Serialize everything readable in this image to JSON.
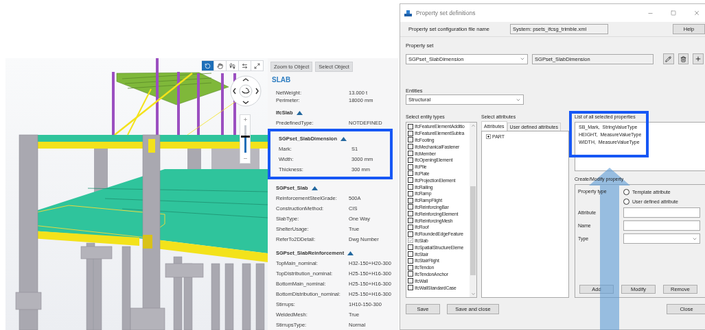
{
  "viewer": {
    "tools": [
      {
        "kind": "orbit",
        "selected": true
      },
      {
        "kind": "pan",
        "selected": false
      },
      {
        "kind": "walk",
        "selected": false
      },
      {
        "kind": "swap",
        "selected": false
      },
      {
        "kind": "fullscreen",
        "selected": false
      }
    ],
    "zoom_slider": {
      "level": 0.6
    }
  },
  "properties_panel": {
    "buttons": [
      "Zoom to Object",
      "Select Object"
    ],
    "title": "SLAB",
    "rows": [
      {
        "label": "NetWeight:",
        "value": "13.000 t"
      },
      {
        "label": "Perimeter:",
        "value": "18000 mm"
      }
    ],
    "groups": [
      {
        "name": "IfcSlab",
        "expanded": true,
        "highlighted": false,
        "rows": [
          {
            "label": "PredefinedType:",
            "value": "NOTDEFINED"
          }
        ]
      },
      {
        "name": "SGPset_SlabDimension",
        "expanded": true,
        "highlighted": true,
        "rows": [
          {
            "label": "Mark:",
            "value": "S1"
          },
          {
            "label": "Width:",
            "value": "3000 mm"
          },
          {
            "label": "Thickness:",
            "value": "300 mm"
          }
        ]
      },
      {
        "name": "SGPset_Slab",
        "expanded": true,
        "highlighted": false,
        "rows": [
          {
            "label": "ReinforcementSteelGrade:",
            "value": "500A"
          },
          {
            "label": "ConstructionMethod:",
            "value": "CIS"
          },
          {
            "label": "SlabType:",
            "value": "One Way"
          },
          {
            "label": "ShelterUsage:",
            "value": "True"
          },
          {
            "label": "ReferTo2DDetail:",
            "value": "Dwg Number"
          }
        ]
      },
      {
        "name": "SGPset_SlabReinforcement",
        "expanded": true,
        "highlighted": false,
        "rows": [
          {
            "label": "TopMain_nominal:",
            "value": "H32-150+H20-300"
          },
          {
            "label": "TopDistribution_nominal:",
            "value": "H25-150+H16-300"
          },
          {
            "label": "BottomMain_nominal:",
            "value": "H25-150+H16-300"
          },
          {
            "label": "BottomDistribution_nominal:",
            "value": "H25-150+H16-300"
          },
          {
            "label": "Stirrups:",
            "value": "1H10-150-300"
          },
          {
            "label": "WeldedMesh:",
            "value": "True"
          },
          {
            "label": "StirrupsType:",
            "value": "Normal"
          }
        ]
      }
    ]
  },
  "dialog": {
    "title": "Property set definitions",
    "config_file": {
      "label": "Property set configuration file name",
      "value": "System: psets_ifcsg_trimble.xml"
    },
    "help_button": "Help",
    "property_set": {
      "label": "Property set",
      "selected": "SGPset_SlabDimension",
      "name": "SGPset_SlabDimension"
    },
    "entities": {
      "label": "Entities",
      "selected": "Structural"
    },
    "entity_types": {
      "label": "Select entity types",
      "items": [
        {
          "name": "IfcFeatureElementAdditio",
          "checked": false
        },
        {
          "name": "IfcFeatureElementSubtra",
          "checked": false
        },
        {
          "name": "IfcFooting",
          "checked": false
        },
        {
          "name": "IfcMechanicalFastener",
          "checked": false
        },
        {
          "name": "IfcMember",
          "checked": false
        },
        {
          "name": "IfcOpeningElement",
          "checked": false
        },
        {
          "name": "IfcPile",
          "checked": false
        },
        {
          "name": "IfcPlate",
          "checked": false
        },
        {
          "name": "IfcProjectionElement",
          "checked": false
        },
        {
          "name": "IfcRailing",
          "checked": false
        },
        {
          "name": "IfcRamp",
          "checked": false
        },
        {
          "name": "IfcRampFlight",
          "checked": false
        },
        {
          "name": "IfcReinforcingBar",
          "checked": false
        },
        {
          "name": "IfcReinforcingElement",
          "checked": false
        },
        {
          "name": "IfcReinforcingMesh",
          "checked": false
        },
        {
          "name": "IfcRoof",
          "checked": false
        },
        {
          "name": "IfcRoundedEdgeFeature",
          "checked": false
        },
        {
          "name": "IfcSlab",
          "checked": true
        },
        {
          "name": "IfcSpatialStructureEleme",
          "checked": false
        },
        {
          "name": "IfcStair",
          "checked": false
        },
        {
          "name": "IfcStairFlight",
          "checked": false
        },
        {
          "name": "IfcTendon",
          "checked": false
        },
        {
          "name": "IfcTendonAnchor",
          "checked": false
        },
        {
          "name": "IfcWall",
          "checked": false
        },
        {
          "name": "IfcWallStandardCase",
          "checked": false
        }
      ]
    },
    "attributes": {
      "label": "Select attributes",
      "tabs": [
        {
          "label": "Attributes",
          "selected": true
        },
        {
          "label": "User defined attributes",
          "selected": false
        }
      ],
      "tree": [
        {
          "name": "PART"
        }
      ]
    },
    "selected_properties": {
      "label": "List of all selected properties",
      "highlighted": true,
      "items": [
        "SB_Mark,  StringValueType",
        "HEIGHT,  MeasureValueType",
        "WIDTH,  MeasureValueType"
      ]
    },
    "create_modify": {
      "label": "Create/Modify property",
      "property_type_label": "Property type",
      "options": [
        {
          "label": "Template attribute",
          "selected": false
        },
        {
          "label": "User defined attribute",
          "selected": false
        }
      ],
      "fields": [
        {
          "label": "Attribute",
          "kind": "text"
        },
        {
          "label": "Name",
          "kind": "text"
        },
        {
          "label": "Type",
          "kind": "select"
        }
      ],
      "buttons": [
        "Add",
        "Modify",
        "Remove"
      ]
    },
    "footer_buttons": [
      "Save",
      "Save and close"
    ],
    "close_button": "Close"
  }
}
